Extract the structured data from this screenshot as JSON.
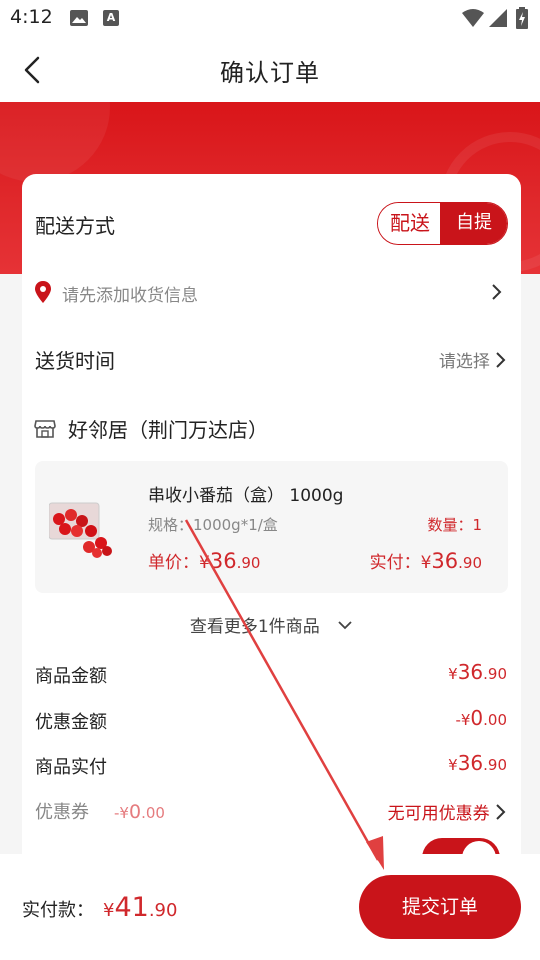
{
  "status_bar": {
    "time": "4:12",
    "icons": [
      "image-icon",
      "a-icon",
      "wifi-icon",
      "signal-icon",
      "battery-icon"
    ]
  },
  "nav": {
    "title": "确认订单",
    "back_icon": "chevron-left-icon"
  },
  "delivery": {
    "label": "配送方式",
    "options": [
      "配送",
      "自提"
    ],
    "selected": "自提"
  },
  "address": {
    "placeholder": "请先添加收货信息"
  },
  "delivery_time": {
    "label": "送货时间",
    "value": "请选择"
  },
  "store": {
    "name": "好邻居（荆门万达店）"
  },
  "product": {
    "name": "串收小番茄（盒） 1000g",
    "spec": "规格：1000g*1/盒",
    "qty": "数量：1",
    "price_label": "单价：",
    "price_currency": "¥",
    "price_int": "36",
    "price_dec": ".90",
    "paid_label": "实付：",
    "paid_currency": "¥",
    "paid_int": "36",
    "paid_dec": ".90"
  },
  "more_items": "查看更多1件商品",
  "summary": [
    {
      "label": "商品金额",
      "sign": "¥",
      "int": "36",
      "dec": ".90"
    },
    {
      "label": "优惠金额",
      "sign": "-¥",
      "int": "0",
      "dec": ".00"
    },
    {
      "label": "商品实付",
      "sign": "¥",
      "int": "36",
      "dec": ".90"
    }
  ],
  "coupon": {
    "label": "优惠券",
    "sign": "-¥",
    "int": "0",
    "dec": ".00",
    "status": "无可用优惠券"
  },
  "bottom": {
    "total_label": "实付款：",
    "total_sign": "¥",
    "total_int": "41",
    "total_dec": ".90",
    "submit": "提交订单"
  },
  "colors": {
    "brand_red": "#c9141a",
    "price_red": "#d0282c",
    "banner_red": "#d91519"
  }
}
